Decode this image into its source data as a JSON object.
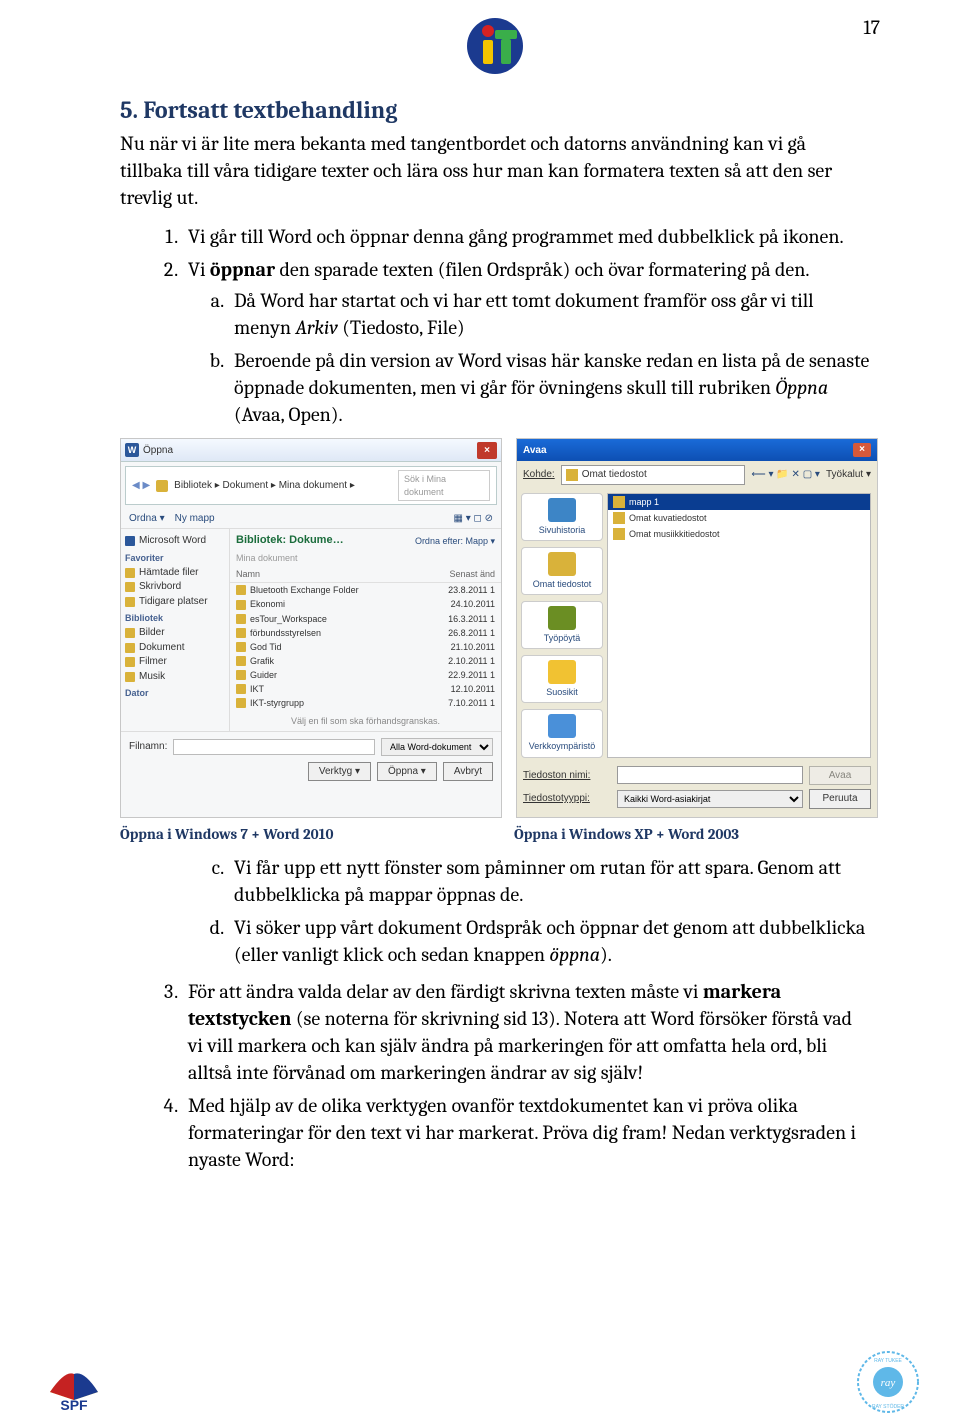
{
  "page_number": "17",
  "logo_alt": "IT logo",
  "heading": "5. Fortsatt textbehandling",
  "intro": "Nu när vi är lite mera bekanta med tangentbordet och datorns användning kan vi gå tillbaka till våra tidigare texter och lära oss hur man kan formatera texten så att den ser trevlig ut.",
  "list1_item1": "Vi går till Word och öppnar denna gång programmet med dubbelklick på ikonen.",
  "list1_item2_pre": "Vi ",
  "list1_item2_bold": "öppnar",
  "list1_item2_post": " den sparade texten (filen Ordspråk) och övar formatering på den.",
  "sub_a_pre": "Då Word har startat och vi har ett tomt dokument framför oss går vi till menyn ",
  "sub_a_italic": "Arkiv",
  "sub_a_post": " (Tiedosto, File)",
  "sub_b_pre": "Beroende på din version av Word visas här kanske redan en lista på de senaste öppnade dokumenten, men vi går för övningens skull till rubriken ",
  "sub_b_italic": "Öppna",
  "sub_b_post": " (Avaa, Open).",
  "caption_left": "Öppna i Windows 7 + Word 2010",
  "caption_right": "Öppna i Windows XP + Word 2003",
  "sub_c": "Vi får upp ett nytt fönster som påminner om rutan för att spara. Genom att dubbelklicka på mappar öppnas de.",
  "sub_d_pre": "Vi söker upp vårt dokument Ordspråk och öppnar det genom att dubbelklicka (eller vanligt klick och sedan knappen ",
  "sub_d_italic": "öppna",
  "sub_d_post": ").",
  "item3_pre": "För att ändra valda delar av den färdigt skrivna texten måste vi ",
  "item3_bold": "markera textstycken",
  "item3_post": " (se noterna för skrivning sid 13). Notera att Word försöker förstå vad vi vill markera och kan själv ändra på markeringen för att omfatta hela ord, bli alltså inte förvånad om markeringen ändrar av sig själv!",
  "item4": "Med hjälp av de olika verktygen ovanför textdokumentet kan vi pröva olika formateringar för den text vi har markerat. Pröva dig fram! Nedan verktygsraden i nyaste Word:",
  "win7": {
    "title": "Öppna",
    "breadcrumb": "Bibliotek ▸ Dokument ▸ Mina dokument ▸",
    "search_placeholder": "Sök i Mina dokument",
    "tb_ordna": "Ordna ▾",
    "tb_nymapp": "Ny mapp",
    "side_word": "Microsoft Word",
    "side_fav": "Favoriter",
    "side_fav_items": [
      "Hämtade filer",
      "Skrivbord",
      "Tidigare platser"
    ],
    "side_bib": "Bibliotek",
    "side_bib_items": [
      "Bilder",
      "Dokument",
      "Filmer",
      "Musik"
    ],
    "side_dator": "Dator",
    "main_header": "Bibliotek: Dokume…",
    "main_sub": "Mina dokument",
    "main_ordna": "Ordna efter: Mapp ▾",
    "col_namn": "Namn",
    "col_date": "Senast änd",
    "files": [
      {
        "n": "Bluetooth Exchange Folder",
        "d": "23.8.2011 1"
      },
      {
        "n": "Ekonomi",
        "d": "24.10.2011"
      },
      {
        "n": "esTour_Workspace",
        "d": "16.3.2011 1"
      },
      {
        "n": "förbundsstyrelsen",
        "d": "26.8.2011 1"
      },
      {
        "n": "God Tid",
        "d": "21.10.2011"
      },
      {
        "n": "Grafik",
        "d": "2.10.2011 1"
      },
      {
        "n": "Guider",
        "d": "22.9.2011 1"
      },
      {
        "n": "IKT",
        "d": "12.10.2011"
      },
      {
        "n": "IKT-styrgrupp",
        "d": "7.10.2011 1"
      }
    ],
    "sug": "Välj en fil som ska förhandsgranskas.",
    "filnamn_label": "Filnamn:",
    "filter": "Alla Word-dokument",
    "verktyg": "Verktyg ▾",
    "btn_open": "Öppna ▾",
    "btn_cancel": "Avbryt"
  },
  "winxp": {
    "title": "Avaa",
    "kohde_label": "Kohde:",
    "kohde_value": "Omat tiedostot",
    "tools": "Työkalut ▾",
    "side_items": [
      "Sivuhistoria",
      "Omat tiedostot",
      "Työpöytä",
      "Suosikit",
      "Verkkoympäristö"
    ],
    "folders": [
      "mapp 1",
      "Omat kuvatiedostot",
      "Omat musiikkitiedostot"
    ],
    "tiedoston_nimi": "Tiedoston nimi:",
    "tiedostotyyppi": "Tiedostotyyppi:",
    "filetype_value": "Kaikki Word-asiakirjat",
    "btn_open": "Avaa",
    "btn_cancel": "Peruuta"
  }
}
